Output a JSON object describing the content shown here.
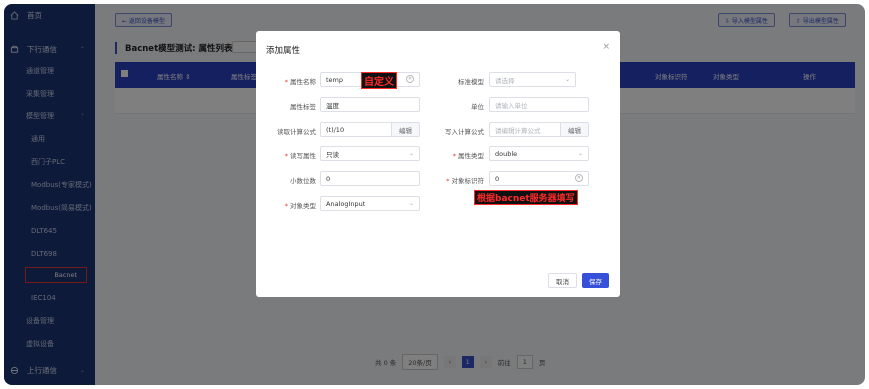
{
  "sidebar": {
    "items": [
      {
        "label": "首页",
        "icon": "home-icon"
      },
      {
        "label": "下行通信",
        "icon": "downlink-icon"
      },
      {
        "label": "通道管理"
      },
      {
        "label": "采集管理"
      },
      {
        "label": "模型管理"
      },
      {
        "label": "通用"
      },
      {
        "label": "西门子PLC"
      },
      {
        "label": "Modbus(专家模式)"
      },
      {
        "label": "Modbus(简易模式)"
      },
      {
        "label": "DLT645"
      },
      {
        "label": "DLT698"
      },
      {
        "label": "Bacnet"
      },
      {
        "label": "IEC104"
      },
      {
        "label": "设备管理"
      },
      {
        "label": "虚拟设备"
      },
      {
        "label": "上行通信",
        "icon": "uplink-icon"
      }
    ]
  },
  "toolbar": {
    "back_label": "← 返回设备模型",
    "import_label": "⇩ 导入模型属性",
    "export_label": "⇧ 导出模型属性"
  },
  "page": {
    "title": "Bacnet模型测试: 属性列表"
  },
  "table": {
    "headers": [
      "属性名称 ⇕",
      "属性标签",
      "对象标识符",
      "对象类型",
      "操作"
    ]
  },
  "pager": {
    "total": "共 0 条",
    "page_size": "20条/页",
    "current": "1",
    "goto_label": "前往",
    "goto_value": "1",
    "page_suffix": "页"
  },
  "dialog": {
    "title": "添加属性",
    "fields": {
      "attr_name": {
        "label": "属性名称",
        "value": "temp"
      },
      "std_model": {
        "label": "标准模型",
        "placeholder": "请选择"
      },
      "attr_tag": {
        "label": "属性标签",
        "value": "温度"
      },
      "unit": {
        "label": "单位",
        "placeholder": "请输入单位"
      },
      "read_formula": {
        "label": "读取计算公式",
        "value": "(t)/10",
        "button": "编辑"
      },
      "write_formula": {
        "label": "写入计算公式",
        "placeholder": "请编辑计算公式",
        "button": "编辑"
      },
      "rw_attr": {
        "label": "读写属性",
        "value": "只读"
      },
      "attr_type": {
        "label": "属性类型",
        "value": "double"
      },
      "decimals": {
        "label": "小数位数",
        "value": "0"
      },
      "object_id": {
        "label": "对象标识符",
        "value": "0"
      },
      "object_type": {
        "label": "对象类型",
        "value": "AnalogInput"
      }
    },
    "annotations": {
      "custom": "自定义",
      "bacnet_hint": "根据bacnet服务器填写"
    },
    "cancel_label": "取消",
    "save_label": "保存"
  },
  "colors": {
    "sidebar": "#1c3474",
    "accent": "#3650d9",
    "table_header": "#2b41c0",
    "annotation": "#ff2a2a"
  }
}
